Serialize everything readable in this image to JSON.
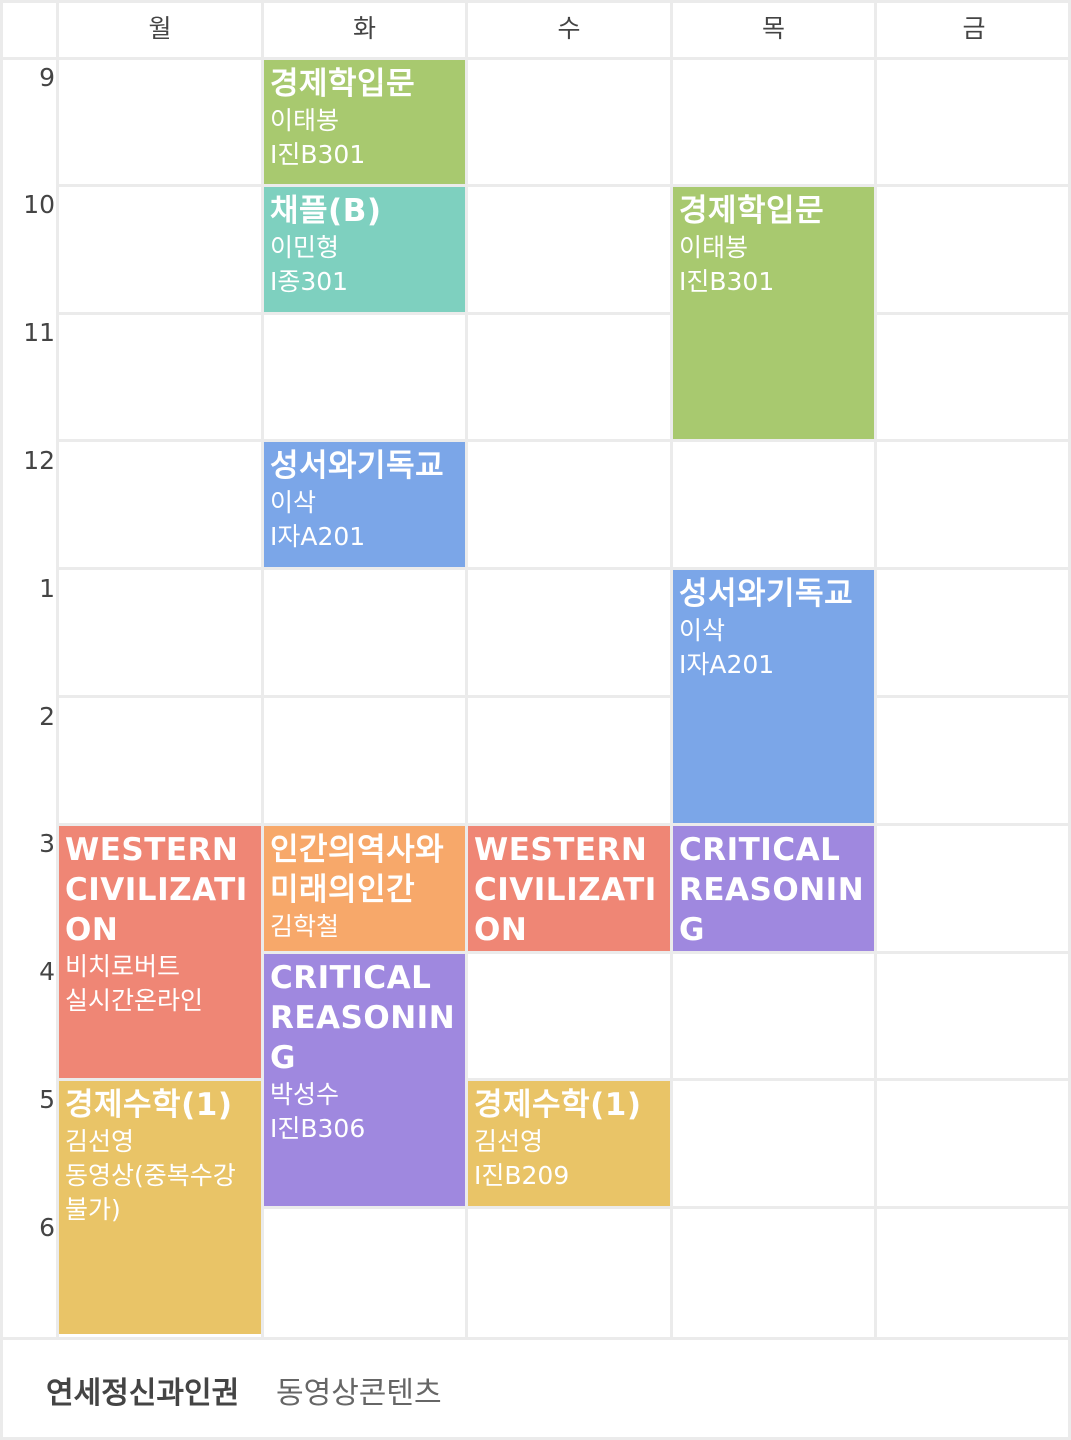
{
  "days": [
    "월",
    "화",
    "수",
    "목",
    "금"
  ],
  "hours": [
    "9",
    "10",
    "11",
    "12",
    "1",
    "2",
    "3",
    "4",
    "5",
    "6"
  ],
  "courses": [
    {
      "id": "c1",
      "title": "경제학입문",
      "professor": "이태봉",
      "room": "I진B301",
      "color": "#a8c96f"
    },
    {
      "id": "c2",
      "title": "채플(B)",
      "professor": "이민형",
      "room": "I종301",
      "color": "#7ed0bf"
    },
    {
      "id": "c3",
      "title": "경제학입문",
      "professor": "이태봉",
      "room": "I진B301",
      "color": "#a8c96f"
    },
    {
      "id": "c4",
      "title": "성서와기독교",
      "professor": "이삭",
      "room": "I자A201",
      "color": "#7ba6e8"
    },
    {
      "id": "c5",
      "title": "성서와기독교",
      "professor": "이삭",
      "room": "I자A201",
      "color": "#7ba6e8"
    },
    {
      "id": "c6",
      "title": "WESTERN CIVILIZATION",
      "professor": "비치로버트",
      "room": "실시간온라인",
      "color": "#ef8675"
    },
    {
      "id": "c7",
      "title": "인간의역사와미래의인간",
      "professor": "김학철",
      "room": "",
      "color": "#f7a86a"
    },
    {
      "id": "c8",
      "title": "WESTERN CIVILIZATION",
      "professor": "",
      "room": "",
      "color": "#ef8675"
    },
    {
      "id": "c9",
      "title": "CRITICAL REASONING",
      "professor": "",
      "room": "",
      "color": "#9f88df"
    },
    {
      "id": "c10",
      "title": "CRITICAL REASONING",
      "professor": "박성수",
      "room": "I진B306",
      "color": "#9f88df"
    },
    {
      "id": "c11",
      "title": "경제수학(1)",
      "professor": "김선영",
      "room": "동영상(중복수강불가)",
      "color": "#e9c467"
    },
    {
      "id": "c12",
      "title": "경제수학(1)",
      "professor": "김선영",
      "room": "I진B209",
      "color": "#e9c467"
    }
  ],
  "footer": {
    "title": "연세정신과인권",
    "subtitle": "동영상콘텐츠"
  }
}
